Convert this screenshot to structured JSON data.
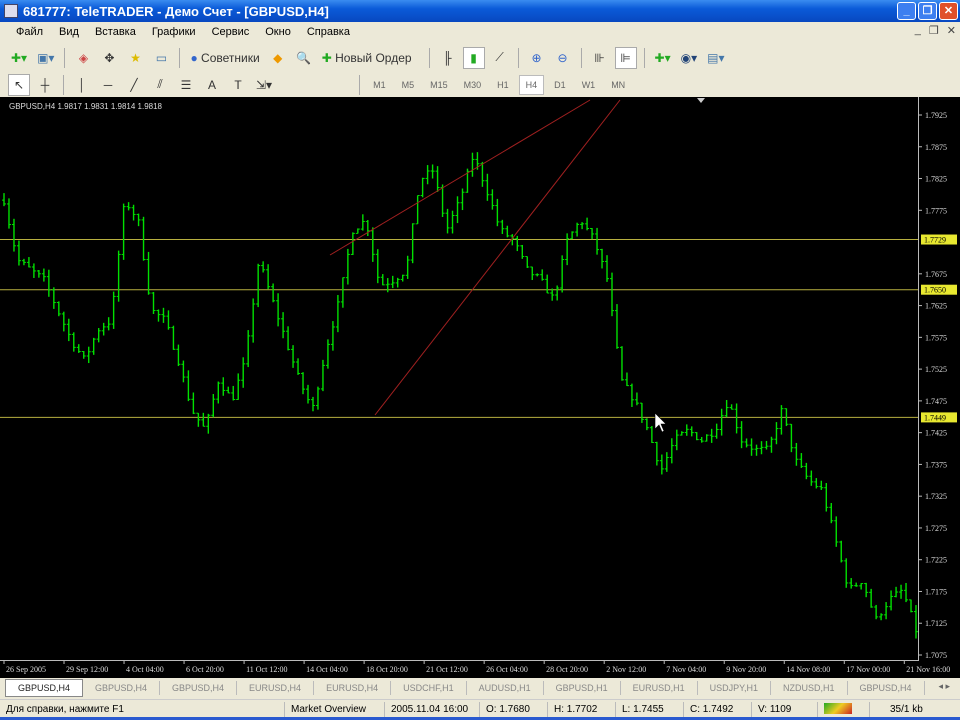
{
  "window": {
    "title": "681777: TeleTRADER - Демо Счет - [GBPUSD,H4]",
    "min": "_",
    "restore": "❐",
    "close": "✕"
  },
  "menu": [
    "Файл",
    "Вид",
    "Вставка",
    "Графики",
    "Сервис",
    "Окно",
    "Справка"
  ],
  "toolbar": {
    "experts_label": "Советники",
    "new_order_label": "Новый Ордер"
  },
  "timeframes": [
    "M1",
    "M5",
    "M15",
    "M30",
    "H1",
    "H4",
    "D1",
    "W1",
    "MN"
  ],
  "active_timeframe": "H4",
  "chart": {
    "header": "GBPUSD,H4  1.9817 1.9831 1.9814 1.9818",
    "price_labels": [
      "1.7925",
      "1.7875",
      "1.7825",
      "1.7775",
      "1.7675",
      "1.7625",
      "1.7575",
      "1.7525",
      "1.7475",
      "1.7425",
      "1.7375",
      "1.7325",
      "1.7275",
      "1.7225",
      "1.7175",
      "1.7125",
      "1.7075"
    ],
    "hlines": [
      "1.7729",
      "1.7650",
      "1.7449"
    ],
    "time_labels": [
      "26 Sep 2005",
      "29 Sep 12:00",
      "4 Oct 04:00",
      "6 Oct 20:00",
      "11 Oct 12:00",
      "14 Oct 04:00",
      "18 Oct 20:00",
      "21 Oct 12:00",
      "26 Oct 04:00",
      "28 Oct 20:00",
      "2 Nov 12:00",
      "7 Nov 04:00",
      "9 Nov 20:00",
      "14 Nov 08:00",
      "17 Nov 00:00",
      "21 Nov 16:00"
    ]
  },
  "chart_data": {
    "type": "bar",
    "symbol": "GBPUSD",
    "timeframe": "H4",
    "ylim": [
      1.7075,
      1.7925
    ],
    "close_keypoints": [
      1.7791,
      1.7697,
      1.7681,
      1.7665,
      1.7618,
      1.7571,
      1.7539,
      1.7587,
      1.7602,
      1.7791,
      1.776,
      1.7618,
      1.7602,
      1.7539,
      1.7461,
      1.7429,
      1.7508,
      1.7476,
      1.7539,
      1.7697,
      1.7634,
      1.7571,
      1.7508,
      1.7461,
      1.7555,
      1.7634,
      1.7744,
      1.776,
      1.7657,
      1.7665,
      1.7681,
      1.7823,
      1.7838,
      1.7744,
      1.7791,
      1.7862,
      1.7807,
      1.7744,
      1.7728,
      1.7681,
      1.7665,
      1.7634,
      1.7728,
      1.776,
      1.7728,
      1.7665,
      1.7508,
      1.7476,
      1.7429,
      1.7366,
      1.7413,
      1.7429,
      1.7413,
      1.7429,
      1.7476,
      1.7413,
      1.7398,
      1.7398,
      1.7461,
      1.7382,
      1.735,
      1.7335,
      1.7256,
      1.7177,
      1.7193,
      1.713,
      1.7162,
      1.7177,
      1.7114
    ]
  },
  "tabs": [
    "GBPUSD,H4",
    "GBPUSD,H4",
    "GBPUSD,H4",
    "EURUSD,H4",
    "EURUSD,H4",
    "USDCHF,H1",
    "AUDUSD,H1",
    "GBPUSD,H1",
    "EURUSD,H1",
    "USDJPY,H1",
    "NZDUSD,H1",
    "GBPUSD,H4"
  ],
  "status": {
    "help": "Для справки, нажмите F1",
    "profile": "Market Overview",
    "datetime": "2005.11.04 16:00",
    "open": "O: 1.7680",
    "high": "H: 1.7702",
    "low": "L: 1.7455",
    "close": "C: 1.7492",
    "volume": "V: 1109",
    "traffic": "35/1 kb"
  }
}
